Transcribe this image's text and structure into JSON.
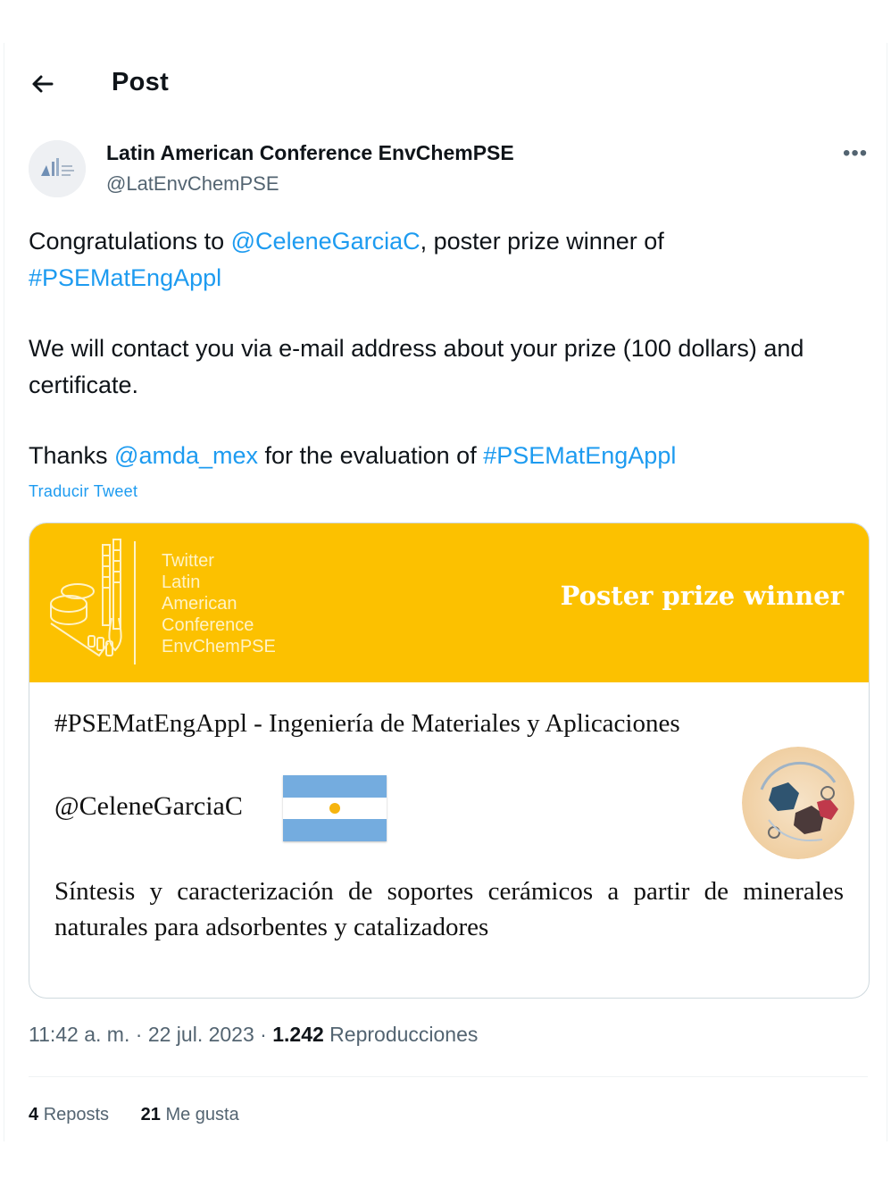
{
  "header": {
    "title": "Post"
  },
  "author": {
    "name": "Latin American Conference EnvChemPSE",
    "handle": "@LatEnvChemPSE"
  },
  "tweet": {
    "p1_pre": "Congratulations to ",
    "p1_mention": "@CeleneGarciaC",
    "p1_post": ", poster prize winner of",
    "p1_hashtag": "#PSEMatEngAppl",
    "p2": "We will contact you via e-mail address about your prize (100 dollars) and certificate.",
    "p3_pre": "Thanks ",
    "p3_mention": "@amda_mex",
    "p3_mid": " for the evaluation of ",
    "p3_hashtag": "#PSEMatEngAppl",
    "translate_label": "Traducir Tweet"
  },
  "card": {
    "logo_lines": [
      "Twitter",
      "Latin",
      "American",
      "Conference",
      "EnvChemPSE"
    ],
    "prize_title": "Poster prize winner",
    "category": "#PSEMatEngAppl - Ingeniería de Materiales y Aplicaciones",
    "winner_handle": "@CeleneGarciaC",
    "poster_title": "Síntesis y caracterización de soportes cerámicos a partir de minerales naturales para adsorbentes y catalizadores",
    "band_color": "#fcc100"
  },
  "meta": {
    "time": "11:42 a. m.",
    "sep": " · ",
    "date": "22 jul. 2023",
    "views": "1.242",
    "views_label": "Reproducciones"
  },
  "stats": {
    "reposts_count": "4",
    "reposts_label": "Reposts",
    "likes_count": "21",
    "likes_label": "Me gusta"
  },
  "colors": {
    "link": "#1d9bf0",
    "muted": "#536471"
  }
}
